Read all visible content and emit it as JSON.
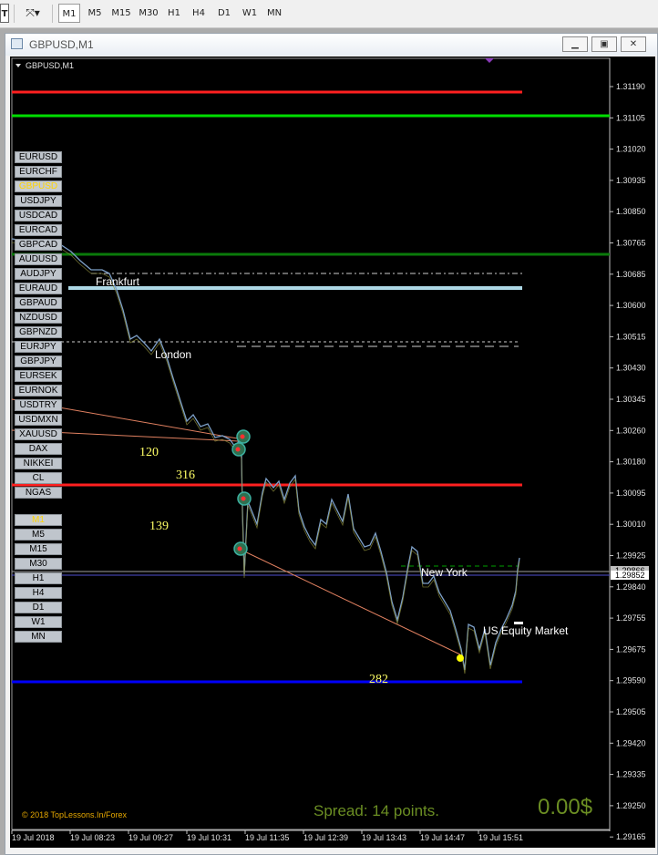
{
  "toolbar": {
    "timeframes": [
      {
        "label": "M1",
        "active": true
      },
      {
        "label": "M5",
        "active": false
      },
      {
        "label": "M15",
        "active": false
      },
      {
        "label": "M30",
        "active": false
      },
      {
        "label": "H1",
        "active": false
      },
      {
        "label": "H4",
        "active": false
      },
      {
        "label": "D1",
        "active": false
      },
      {
        "label": "W1",
        "active": false
      },
      {
        "label": "MN",
        "active": false
      }
    ],
    "icons": [
      "text-tool-icon",
      "objects-menu-icon"
    ]
  },
  "window": {
    "title": "GBPUSD,M1",
    "buttons": [
      "minimize",
      "restore",
      "close"
    ]
  },
  "chart": {
    "symbol_label": "GBPUSD,M1",
    "price_axis": [
      "1.31190",
      "1.31105",
      "1.31020",
      "1.30935",
      "1.30850",
      "1.30765",
      "1.30685",
      "1.30600",
      "1.30515",
      "1.30430",
      "1.30345",
      "1.30260",
      "1.30180",
      "1.30095",
      "1.30010",
      "1.29925",
      "1.29840",
      "1.29755",
      "1.29675",
      "1.29590",
      "1.29505",
      "1.29420",
      "1.29335",
      "1.29250",
      "1.29165"
    ],
    "current_price": "1.29852",
    "ask_label": "1.29866",
    "time_axis": [
      "19 Jul 2018",
      "19 Jul 08:23",
      "19 Jul 09:27",
      "19 Jul 10:31",
      "19 Jul 11:35",
      "19 Jul 12:39",
      "19 Jul 13:43",
      "19 Jul 14:47",
      "19 Jul 15:51"
    ],
    "session_labels": [
      "Frankfurt",
      "London",
      "New York",
      "US Equity Market"
    ],
    "numbers": [
      "120",
      "316",
      "139",
      "282"
    ],
    "copyright": "© 2018 TopLessons.In/Forex",
    "spread": "Spread: 14 points.",
    "profit": "0.00$",
    "colors": {
      "background": "#000000",
      "price_line": "#7da0c8",
      "resistance": "#ff1a1a",
      "support": "#0000ff",
      "level_green": "#00cc00",
      "dark_green": "#0a7a0a",
      "light_band": "#add8e6",
      "numbers": "#ffff66",
      "spread": "#6b8e23"
    }
  },
  "symbols": [
    {
      "label": "EURUSD",
      "active": false
    },
    {
      "label": "EURCHF",
      "active": false
    },
    {
      "label": "GBPUSD",
      "active": true
    },
    {
      "label": "USDJPY",
      "active": false
    },
    {
      "label": "USDCAD",
      "active": false
    },
    {
      "label": "EURCAD",
      "active": false
    },
    {
      "label": "GBPCAD",
      "active": false
    },
    {
      "label": "AUDUSD",
      "active": false
    },
    {
      "label": "AUDJPY",
      "active": false
    },
    {
      "label": "EURAUD",
      "active": false
    },
    {
      "label": "GBPAUD",
      "active": false
    },
    {
      "label": "NZDUSD",
      "active": false
    },
    {
      "label": "GBPNZD",
      "active": false
    },
    {
      "label": "EURJPY",
      "active": false
    },
    {
      "label": "GBPJPY",
      "active": false
    },
    {
      "label": "EURSEK",
      "active": false
    },
    {
      "label": "EURNOK",
      "active": false
    },
    {
      "label": "USDTRY",
      "active": false
    },
    {
      "label": "USDMXN",
      "active": false
    },
    {
      "label": "XAUUSD",
      "active": false
    },
    {
      "label": "DAX",
      "active": false
    },
    {
      "label": "NIKKEI",
      "active": false
    },
    {
      "label": "CL",
      "active": false
    },
    {
      "label": "NGAS",
      "active": false
    }
  ],
  "timeframe_buttons": [
    {
      "label": "M1",
      "active": true
    },
    {
      "label": "M5",
      "active": false
    },
    {
      "label": "M15",
      "active": false
    },
    {
      "label": "M30",
      "active": false
    },
    {
      "label": "H1",
      "active": false
    },
    {
      "label": "H4",
      "active": false
    },
    {
      "label": "D1",
      "active": false
    },
    {
      "label": "W1",
      "active": false
    },
    {
      "label": "MN",
      "active": false
    }
  ]
}
